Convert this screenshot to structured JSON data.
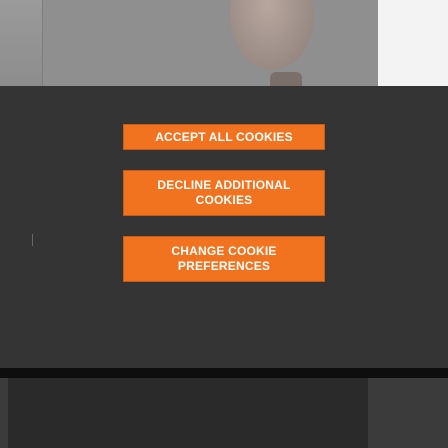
{
  "cookie_consent": {
    "accept_all_label": "ACCEPT ALL COOKIES",
    "decline_label": "DECLINE ADDITIONAL COOKIES",
    "preferences_label": "CHANGE COOKIE PREFERENCES"
  },
  "colors": {
    "button_orange": "#f2731f",
    "panel_dark": "#343434",
    "button_text": "#ffffff"
  },
  "background": {
    "photo_icon": "person-photo"
  }
}
